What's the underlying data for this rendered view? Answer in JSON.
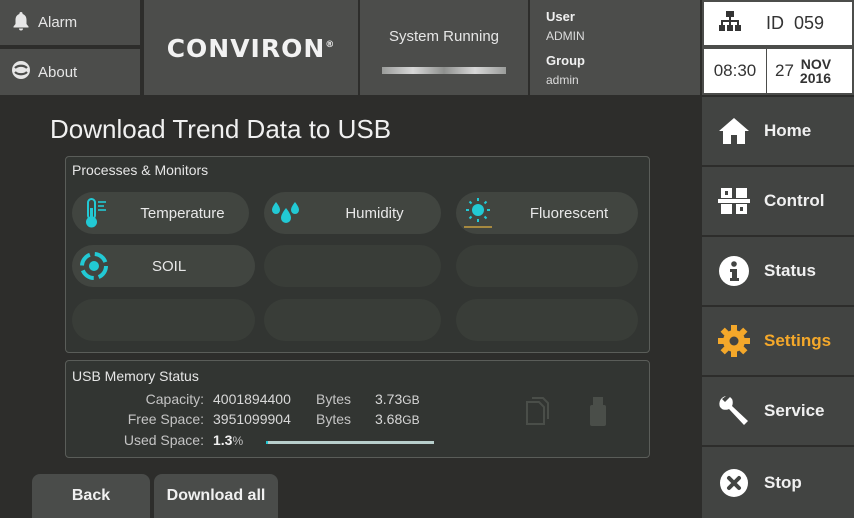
{
  "header": {
    "alarm_label": "Alarm",
    "about_label": "About",
    "logo_text": "CONVIRON",
    "logo_mark": "®",
    "status_text": "System Running",
    "user_label": "User",
    "user_value": "ADMIN",
    "group_label": "Group",
    "group_value": "admin",
    "id_label": "ID",
    "id_value": "059",
    "time": "08:30",
    "day": "27",
    "month": "NOV",
    "year": "2016"
  },
  "page": {
    "title": "Download Trend Data to USB"
  },
  "processes": {
    "title": "Processes & Monitors",
    "items": [
      {
        "label": "Temperature",
        "icon": "thermometer-icon"
      },
      {
        "label": "Humidity",
        "icon": "water-drops-icon"
      },
      {
        "label": "Fluorescent",
        "icon": "light-sun-icon"
      },
      {
        "label": "SOIL",
        "icon": "soil-target-icon"
      }
    ]
  },
  "usb": {
    "title": "USB Memory Status",
    "capacity_label": "Capacity:",
    "capacity_bytes": "4001894400",
    "bytes_unit": "Bytes",
    "capacity_gb": "3.73",
    "free_label": "Free Space:",
    "free_bytes": "3951099904",
    "free_gb": "3.68",
    "gb_unit": "GB",
    "used_label": "Used Space:",
    "used_value": "1.3",
    "used_unit": "%",
    "used_fraction": 0.013
  },
  "sidebar": {
    "items": [
      {
        "label": "Home",
        "icon": "home-icon"
      },
      {
        "label": "Control",
        "icon": "control-icon"
      },
      {
        "label": "Status",
        "icon": "info-icon"
      },
      {
        "label": "Settings",
        "icon": "gear-icon"
      },
      {
        "label": "Service",
        "icon": "wrench-icon"
      },
      {
        "label": "Stop",
        "icon": "stop-icon"
      }
    ]
  },
  "footer": {
    "back_label": "Back",
    "download_label": "Download all"
  },
  "colors": {
    "accent_teal": "#22c9d4",
    "active_orange": "#f4a82a"
  }
}
